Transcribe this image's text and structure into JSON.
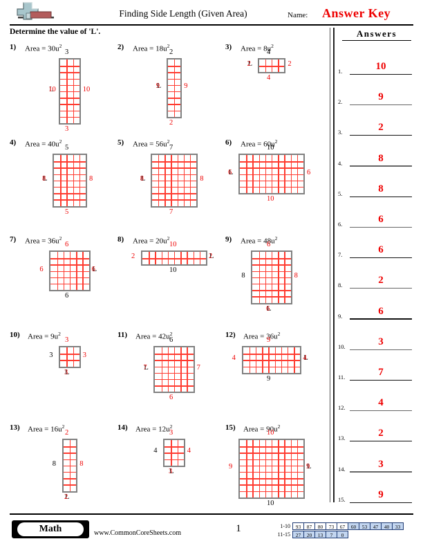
{
  "header": {
    "title": "Finding Side Length (Given Area)",
    "name_label": "Name:",
    "answer_key": "Answer Key",
    "logo_icon": "plus-block-logo"
  },
  "instruction": "Determine the value of 'L'.",
  "answers_panel": {
    "heading": "Answers",
    "items": [
      {
        "num": "1.",
        "value": "10"
      },
      {
        "num": "2.",
        "value": "9"
      },
      {
        "num": "3.",
        "value": "2"
      },
      {
        "num": "4.",
        "value": "8"
      },
      {
        "num": "5.",
        "value": "8"
      },
      {
        "num": "6.",
        "value": "6"
      },
      {
        "num": "7.",
        "value": "6"
      },
      {
        "num": "8.",
        "value": "2"
      },
      {
        "num": "9.",
        "value": "6"
      },
      {
        "num": "10.",
        "value": "3"
      },
      {
        "num": "11.",
        "value": "7"
      },
      {
        "num": "12.",
        "value": "4"
      },
      {
        "num": "13.",
        "value": "2"
      },
      {
        "num": "14.",
        "value": "3"
      },
      {
        "num": "15.",
        "value": "9"
      }
    ]
  },
  "problems": [
    {
      "num": "1)",
      "area_text": "Area = 30u",
      "exp": "2",
      "cols": 3,
      "rows": 10,
      "top": "3",
      "top_color": "black",
      "bottom": "3",
      "bottom_color": "red",
      "left": "L",
      "left_color": "overlap",
      "left_over": "10",
      "right": "10",
      "right_color": "red"
    },
    {
      "num": "2)",
      "area_text": "Area = 18u",
      "exp": "2",
      "cols": 2,
      "rows": 9,
      "top": "2",
      "top_color": "black",
      "bottom": "2",
      "bottom_color": "red",
      "left": "L",
      "left_color": "overlap",
      "left_over": "9",
      "right": "9",
      "right_color": "red"
    },
    {
      "num": "3)",
      "area_text": "Area = 8u",
      "exp": "2",
      "cols": 4,
      "rows": 2,
      "top": "4",
      "top_color": "black",
      "bottom": "4",
      "bottom_color": "red",
      "left": "L",
      "left_color": "overlap",
      "left_over": "2",
      "right": "2",
      "right_color": "red"
    },
    {
      "num": "4)",
      "area_text": "Area = 40u",
      "exp": "2",
      "cols": 5,
      "rows": 8,
      "top": "5",
      "top_color": "black",
      "bottom": "5",
      "bottom_color": "red",
      "left": "L",
      "left_color": "overlap",
      "left_over": "8",
      "right": "8",
      "right_color": "red"
    },
    {
      "num": "5)",
      "area_text": "Area = 56u",
      "exp": "2",
      "cols": 7,
      "rows": 8,
      "top": "7",
      "top_color": "black",
      "bottom": "7",
      "bottom_color": "red",
      "left": "L",
      "left_color": "overlap",
      "left_over": "8",
      "right": "8",
      "right_color": "red"
    },
    {
      "num": "6)",
      "area_text": "Area = 60u",
      "exp": "2",
      "cols": 10,
      "rows": 6,
      "top": "10",
      "top_color": "black",
      "bottom": "10",
      "bottom_color": "red",
      "left": "L",
      "left_color": "overlap",
      "left_over": "6",
      "right": "6",
      "right_color": "red"
    },
    {
      "num": "7)",
      "area_text": "Area = 36u",
      "exp": "2",
      "cols": 6,
      "rows": 6,
      "top": "6",
      "top_color": "red",
      "bottom": "6",
      "bottom_color": "black",
      "left": "6",
      "left_color": "red",
      "right": "L",
      "right_color": "overlap",
      "right_over": "6"
    },
    {
      "num": "8)",
      "area_text": "Area = 20u",
      "exp": "2",
      "cols": 10,
      "rows": 2,
      "top": "10",
      "top_color": "red",
      "bottom": "10",
      "bottom_color": "black",
      "left": "2",
      "left_color": "red",
      "right": "L",
      "right_color": "overlap",
      "right_over": "2"
    },
    {
      "num": "9)",
      "area_text": "Area = 48u",
      "exp": "2",
      "cols": 6,
      "rows": 8,
      "top": "6",
      "top_color": "red",
      "bottom": "L",
      "bottom_color": "overlap",
      "bottom_over": "6",
      "left": "8",
      "left_color": "black",
      "right": "8",
      "right_color": "red"
    },
    {
      "num": "10)",
      "area_text": "Area = 9u",
      "exp": "2",
      "cols": 3,
      "rows": 3,
      "top": "3",
      "top_color": "red",
      "bottom": "L",
      "bottom_color": "overlap",
      "bottom_over": "3",
      "left": "3",
      "left_color": "black",
      "right": "3",
      "right_color": "red"
    },
    {
      "num": "11)",
      "area_text": "Area = 42u",
      "exp": "2",
      "cols": 6,
      "rows": 7,
      "top": "6",
      "top_color": "black",
      "bottom": "6",
      "bottom_color": "red",
      "left": "L",
      "left_color": "overlap",
      "left_over": "7",
      "right": "7",
      "right_color": "red"
    },
    {
      "num": "12)",
      "area_text": "Area = 36u",
      "exp": "2",
      "cols": 9,
      "rows": 4,
      "top": "9",
      "top_color": "red",
      "bottom": "9",
      "bottom_color": "black",
      "left": "4",
      "left_color": "red",
      "right": "L",
      "right_color": "overlap",
      "right_over": "4"
    },
    {
      "num": "13)",
      "area_text": "Area = 16u",
      "exp": "2",
      "cols": 2,
      "rows": 8,
      "top": "2",
      "top_color": "red",
      "bottom": "L",
      "bottom_color": "overlap",
      "bottom_over": "2",
      "left": "8",
      "left_color": "black",
      "right": "8",
      "right_color": "red"
    },
    {
      "num": "14)",
      "area_text": "Area = 12u",
      "exp": "2",
      "cols": 3,
      "rows": 4,
      "top": "3",
      "top_color": "red",
      "bottom": "L",
      "bottom_color": "overlap",
      "bottom_over": "3",
      "left": "4",
      "left_color": "black",
      "right": "4",
      "right_color": "red"
    },
    {
      "num": "15)",
      "area_text": "Area = 90u",
      "exp": "2",
      "cols": 10,
      "rows": 9,
      "top": "10",
      "top_color": "red",
      "bottom": "10",
      "bottom_color": "black",
      "left": "9",
      "left_color": "red",
      "right": "L",
      "right_color": "overlap",
      "right_over": "9"
    }
  ],
  "footer": {
    "subject": "Math",
    "url": "www.CommonCoreSheets.com",
    "page": "1",
    "score_table": {
      "rows": [
        {
          "label": "1-10",
          "cells": [
            {
              "value": "93",
              "shade": "white"
            },
            {
              "value": "87",
              "shade": "white"
            },
            {
              "value": "80",
              "shade": "white"
            },
            {
              "value": "73",
              "shade": "white"
            },
            {
              "value": "67",
              "shade": "white"
            },
            {
              "value": "60",
              "shade": "blue"
            },
            {
              "value": "53",
              "shade": "blue"
            },
            {
              "value": "47",
              "shade": "blue"
            },
            {
              "value": "40",
              "shade": "blue"
            },
            {
              "value": "33",
              "shade": "blue"
            }
          ]
        },
        {
          "label": "11-15",
          "cells": [
            {
              "value": "27",
              "shade": "blue"
            },
            {
              "value": "20",
              "shade": "blue"
            },
            {
              "value": "13",
              "shade": "blue"
            },
            {
              "value": "7",
              "shade": "blue"
            },
            {
              "value": "0",
              "shade": "blue"
            }
          ]
        }
      ]
    }
  },
  "colors": {
    "answer_red": "#ee0000",
    "grid_line_red": "#ff3b30",
    "grid_border_gray": "#808080",
    "score_blue": "#c3d6f0",
    "logo_blue": "#a8c6cc",
    "logo_red": "#b35c5c"
  }
}
